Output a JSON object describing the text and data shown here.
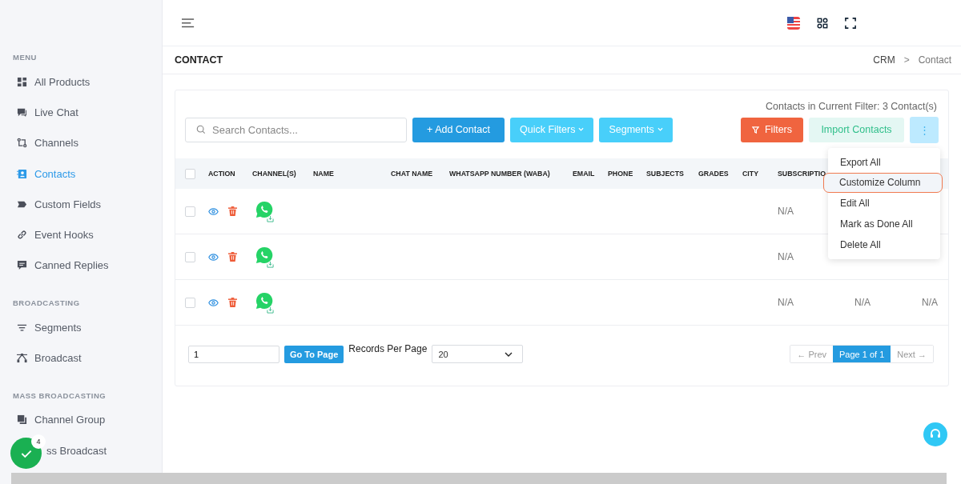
{
  "sidebar": {
    "sections": [
      {
        "title": "MENU",
        "items": [
          {
            "label": "All Products",
            "selected": false
          },
          {
            "label": "Live Chat",
            "selected": false
          },
          {
            "label": "Channels",
            "selected": false
          },
          {
            "label": "Contacts",
            "selected": true
          },
          {
            "label": "Custom Fields",
            "selected": false
          },
          {
            "label": "Event Hooks",
            "selected": false
          },
          {
            "label": "Canned Replies",
            "selected": false
          }
        ]
      },
      {
        "title": "BROADCASTING",
        "items": [
          {
            "label": "Segments",
            "selected": false
          },
          {
            "label": "Broadcast",
            "selected": false
          }
        ]
      },
      {
        "title": "MASS BROADCASTING",
        "items": [
          {
            "label": "Channel Group",
            "selected": false
          },
          {
            "label": "ss Broadcast",
            "selected": false
          }
        ]
      }
    ]
  },
  "floating_badge": {
    "count": "4"
  },
  "page": {
    "title": "CONTACT",
    "breadcrumb": [
      {
        "label": "CRM",
        "current": false
      },
      {
        "label": "Contact",
        "current": true
      }
    ],
    "breadcrumb_separator": ">"
  },
  "contacts_count": "Contacts in Current Filter: 3 Contact(s)",
  "search": {
    "placeholder": "Search Contacts..."
  },
  "toolbar": {
    "add": "+  Add Contact",
    "quick_filters": "Quick Filters",
    "segments": "Segments",
    "filters": "Filters",
    "import": "Import Contacts",
    "more": "⋮"
  },
  "table": {
    "columns": [
      "ACTION",
      "CHANNEL(S)",
      "NAME",
      "CHAT NAME",
      "WHATSAPP NUMBER (WABA)",
      "EMAIL",
      "PHONE",
      "SUBJECTS",
      "GRADES",
      "CITY",
      "SUBSCRIPTIO"
    ],
    "select_all_checked": false,
    "rows": [
      {
        "checked": false,
        "cells": [
          "N/A"
        ]
      },
      {
        "checked": false,
        "cells": [
          "N/A"
        ]
      },
      {
        "checked": false,
        "cells": [
          "N/A",
          "N/A",
          "N/A"
        ]
      }
    ]
  },
  "menu": {
    "items": [
      {
        "label": "Export All",
        "selected": false
      },
      {
        "label": "Customize Column",
        "selected": true
      },
      {
        "label": "Edit All",
        "selected": false
      },
      {
        "label": "Mark as Done All",
        "selected": false
      },
      {
        "label": "Delete All",
        "selected": false
      }
    ]
  },
  "pagination": {
    "page_input": "1",
    "go": "Go To Page",
    "per_page_label": "Records Per Page",
    "per_page": "20",
    "prev": "←  Prev",
    "current": "Page 1 of 1",
    "next": "Next  →"
  }
}
